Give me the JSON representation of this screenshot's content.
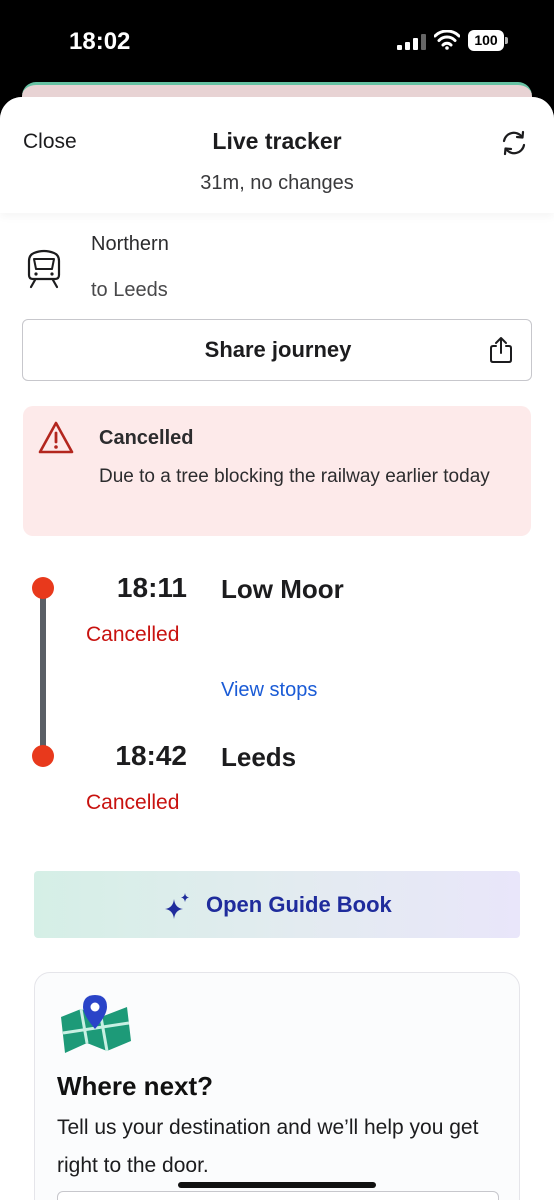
{
  "status_bar": {
    "time": "18:02",
    "battery": "100"
  },
  "header": {
    "close_label": "Close",
    "title": "Live tracker",
    "subtitle": "31m, no changes",
    "refresh_icon": "refresh-icon"
  },
  "operator": {
    "name": "Northern",
    "destination": "to Leeds",
    "icon": "train-icon"
  },
  "share": {
    "label": "Share journey",
    "icon": "share-icon"
  },
  "alert": {
    "title": "Cancelled",
    "text": "Due to a tree blocking the railway earlier today",
    "icon": "warning-icon"
  },
  "journey": {
    "stops": [
      {
        "time": "18:11",
        "station": "Low Moor",
        "status": "Cancelled"
      },
      {
        "time": "18:42",
        "station": "Leeds",
        "status": "Cancelled"
      }
    ],
    "view_stops_label": "View stops"
  },
  "guide": {
    "label": "Open Guide Book",
    "icon": "sparkle-icon"
  },
  "where_next": {
    "title": "Where next?",
    "text": "Tell us your destination and we’ll help you get right to the door.",
    "icon": "map-pin-icon"
  },
  "colors": {
    "accent_red": "#e8391c",
    "cancel_red": "#c8120f",
    "link_blue": "#1a5bd6",
    "guide_blue": "#1f2c9c",
    "alert_bg": "#fdeaea"
  }
}
